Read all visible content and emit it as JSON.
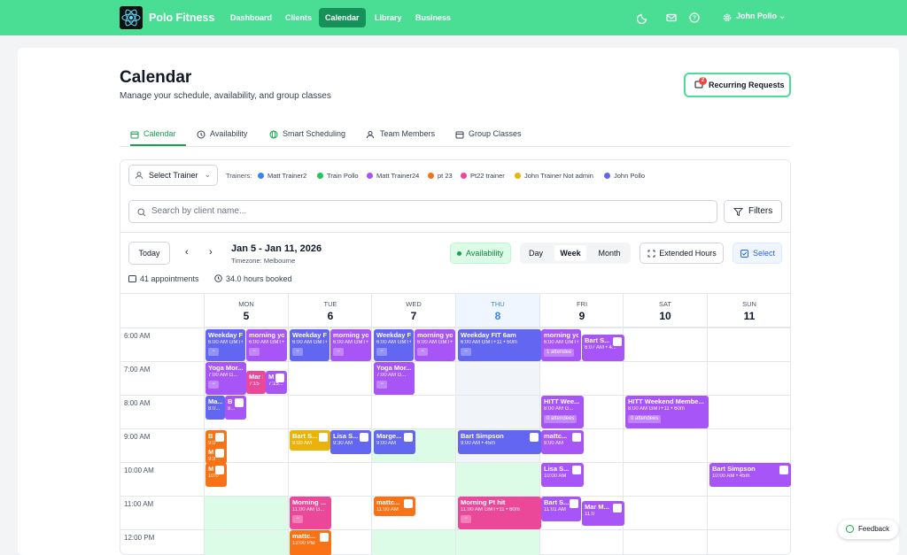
{
  "topbar": {
    "brand": "Polo Fitness",
    "nav": [
      "Dashboard",
      "Clients",
      "Calendar",
      "Library",
      "Business"
    ],
    "active_nav": "Calendar",
    "user_name": "John Pollo",
    "icons": [
      "moon-icon",
      "mail-icon",
      "help-icon",
      "gear-icon",
      "chevron-down-icon"
    ]
  },
  "header": {
    "title": "Calendar",
    "subtitle": "Manage your schedule, availability, and group classes",
    "recurring_label": "Recurring Requests",
    "recurring_count": "2"
  },
  "tabs": [
    "Calendar",
    "Availability",
    "Smart Scheduling",
    "Team Members",
    "Group Classes"
  ],
  "filters": {
    "select_trainer": "Select Trainer",
    "trainers_label": "Trainers:",
    "trainers": [
      {
        "name": "Matt Trainer2",
        "color": "#3b82f6"
      },
      {
        "name": "Train Pollo",
        "color": "#22c55e"
      },
      {
        "name": "Matt Trainer24",
        "color": "#a855f7"
      },
      {
        "name": "pt 23",
        "color": "#f97316"
      },
      {
        "name": "Pt22 trainer",
        "color": "#ec4899"
      },
      {
        "name": "John Trainer Not admin",
        "color": "#eab308"
      },
      {
        "name": "John Pollo",
        "color": "#6366f1"
      }
    ],
    "search_placeholder": "Search by client name...",
    "filters_label": "Filters"
  },
  "toolbar": {
    "today": "Today",
    "range": "Jan 5 - Jan 11, 2026",
    "timezone": "Timezone: Melbourne",
    "availability": "Availability",
    "views": [
      "Day",
      "Week",
      "Month"
    ],
    "active_view": "Week",
    "extended": "Extended Hours",
    "select": "Select"
  },
  "stats": {
    "appointments": "41 appointments",
    "hours": "34.0 hours booked"
  },
  "days": [
    {
      "name": "MON",
      "date": "5"
    },
    {
      "name": "TUE",
      "date": "6"
    },
    {
      "name": "WED",
      "date": "7"
    },
    {
      "name": "THU",
      "date": "8",
      "today": true
    },
    {
      "name": "FRI",
      "date": "9"
    },
    {
      "name": "SAT",
      "date": "10"
    },
    {
      "name": "SUN",
      "date": "11"
    }
  ],
  "times": [
    "6:00 AM",
    "7:00 AM",
    "8:00 AM",
    "9:00 AM",
    "10:00 AM",
    "11:00 AM",
    "12:00 PM"
  ],
  "events": [
    {
      "t": "Weekday FIT 6am",
      "s": "6:00 AM GMT+11",
      "c": "#6366f1"
    },
    {
      "t": "morning yoga",
      "s": "6:00 AM GMT+11",
      "c": "#a855f7"
    },
    {
      "t": "Weekday FIT 6am",
      "s": "6:00 AM GMT+11",
      "c": "#6366f1"
    },
    {
      "t": "morning yoga",
      "s": "6:00 AM GMT+11",
      "c": "#a855f7"
    },
    {
      "t": "Weekday FIT 6am",
      "s": "6:00 AM GMT+11",
      "c": "#6366f1"
    },
    {
      "t": "morning yoga",
      "s": "6:00 AM GMT+11",
      "c": "#a855f7"
    },
    {
      "t": "Weekday FIT 6am",
      "s": "6:00 AM GMT+11 • 60m",
      "c": "#6366f1"
    },
    {
      "t": "morning yoga",
      "s": "6:00 AM GMT+11",
      "c": "#a855f7"
    },
    {
      "t": "Bart S...",
      "s": "6:07 AM • 4...",
      "c": "#a855f7"
    },
    {
      "t": "Yoga Mor...",
      "s": "7:00 AM G...",
      "c": "#a855f7"
    },
    {
      "t": "Mar M",
      "s": "7:15",
      "c": "#ec4899"
    },
    {
      "t": "M",
      "s": "7:15...",
      "c": "#a855f7"
    },
    {
      "t": "Yoga Mor...",
      "s": "7:00 AM G...",
      "c": "#a855f7"
    },
    {
      "t": "Ma...",
      "s": "8:0...",
      "c": "#6366f1"
    },
    {
      "t": "B",
      "s": "8...",
      "c": "#a855f7"
    },
    {
      "t": "HITT Wee...",
      "s": "8:00 AM G...",
      "c": "#a855f7"
    },
    {
      "t": "HITT Weekend Membe...",
      "s": "8:00 AM GMT+11 • 60m",
      "c": "#a855f7"
    },
    {
      "t": "B",
      "s": "9:0",
      "c": "#f97316"
    },
    {
      "t": "Bart S...",
      "s": "9:00 AM",
      "c": "#eab308"
    },
    {
      "t": "Lisa S...",
      "s": "9:30 AM",
      "c": "#6366f1"
    },
    {
      "t": "Marge...",
      "s": "9:00 AM",
      "c": "#6366f1"
    },
    {
      "t": "Bart Simpson",
      "s": "9:00 AM • 45m",
      "c": "#6366f1"
    },
    {
      "t": "mattc...",
      "s": "9:00 AM",
      "c": "#a855f7"
    },
    {
      "t": "M",
      "s": "9:3",
      "c": "#f97316"
    },
    {
      "t": "M",
      "s": "10:0",
      "c": "#f97316"
    },
    {
      "t": "Lisa S...",
      "s": "10:00 AM",
      "c": "#a855f7"
    },
    {
      "t": "Bart Simpson",
      "s": "10:00 AM • 45m",
      "c": "#a855f7"
    },
    {
      "t": "Morning ...",
      "s": "11:00 AM G...",
      "c": "#ec4899"
    },
    {
      "t": "mattc...",
      "s": "11:00 AM",
      "c": "#f97316"
    },
    {
      "t": "Morning Pt hit",
      "s": "11:00 AM GMT+11 • 60m",
      "c": "#ec4899"
    },
    {
      "t": "Bart S...",
      "s": "11:01 AM",
      "c": "#a855f7"
    },
    {
      "t": "Mar M...",
      "s": "11:0",
      "c": "#a855f7"
    },
    {
      "t": "mattc...",
      "s": "12:00 PM",
      "c": "#f97316"
    }
  ],
  "attendees": {
    "fri": "1 attendee",
    "sat": "0 attendees",
    "fri8": "0 attendees"
  },
  "feedback": "Feedback"
}
